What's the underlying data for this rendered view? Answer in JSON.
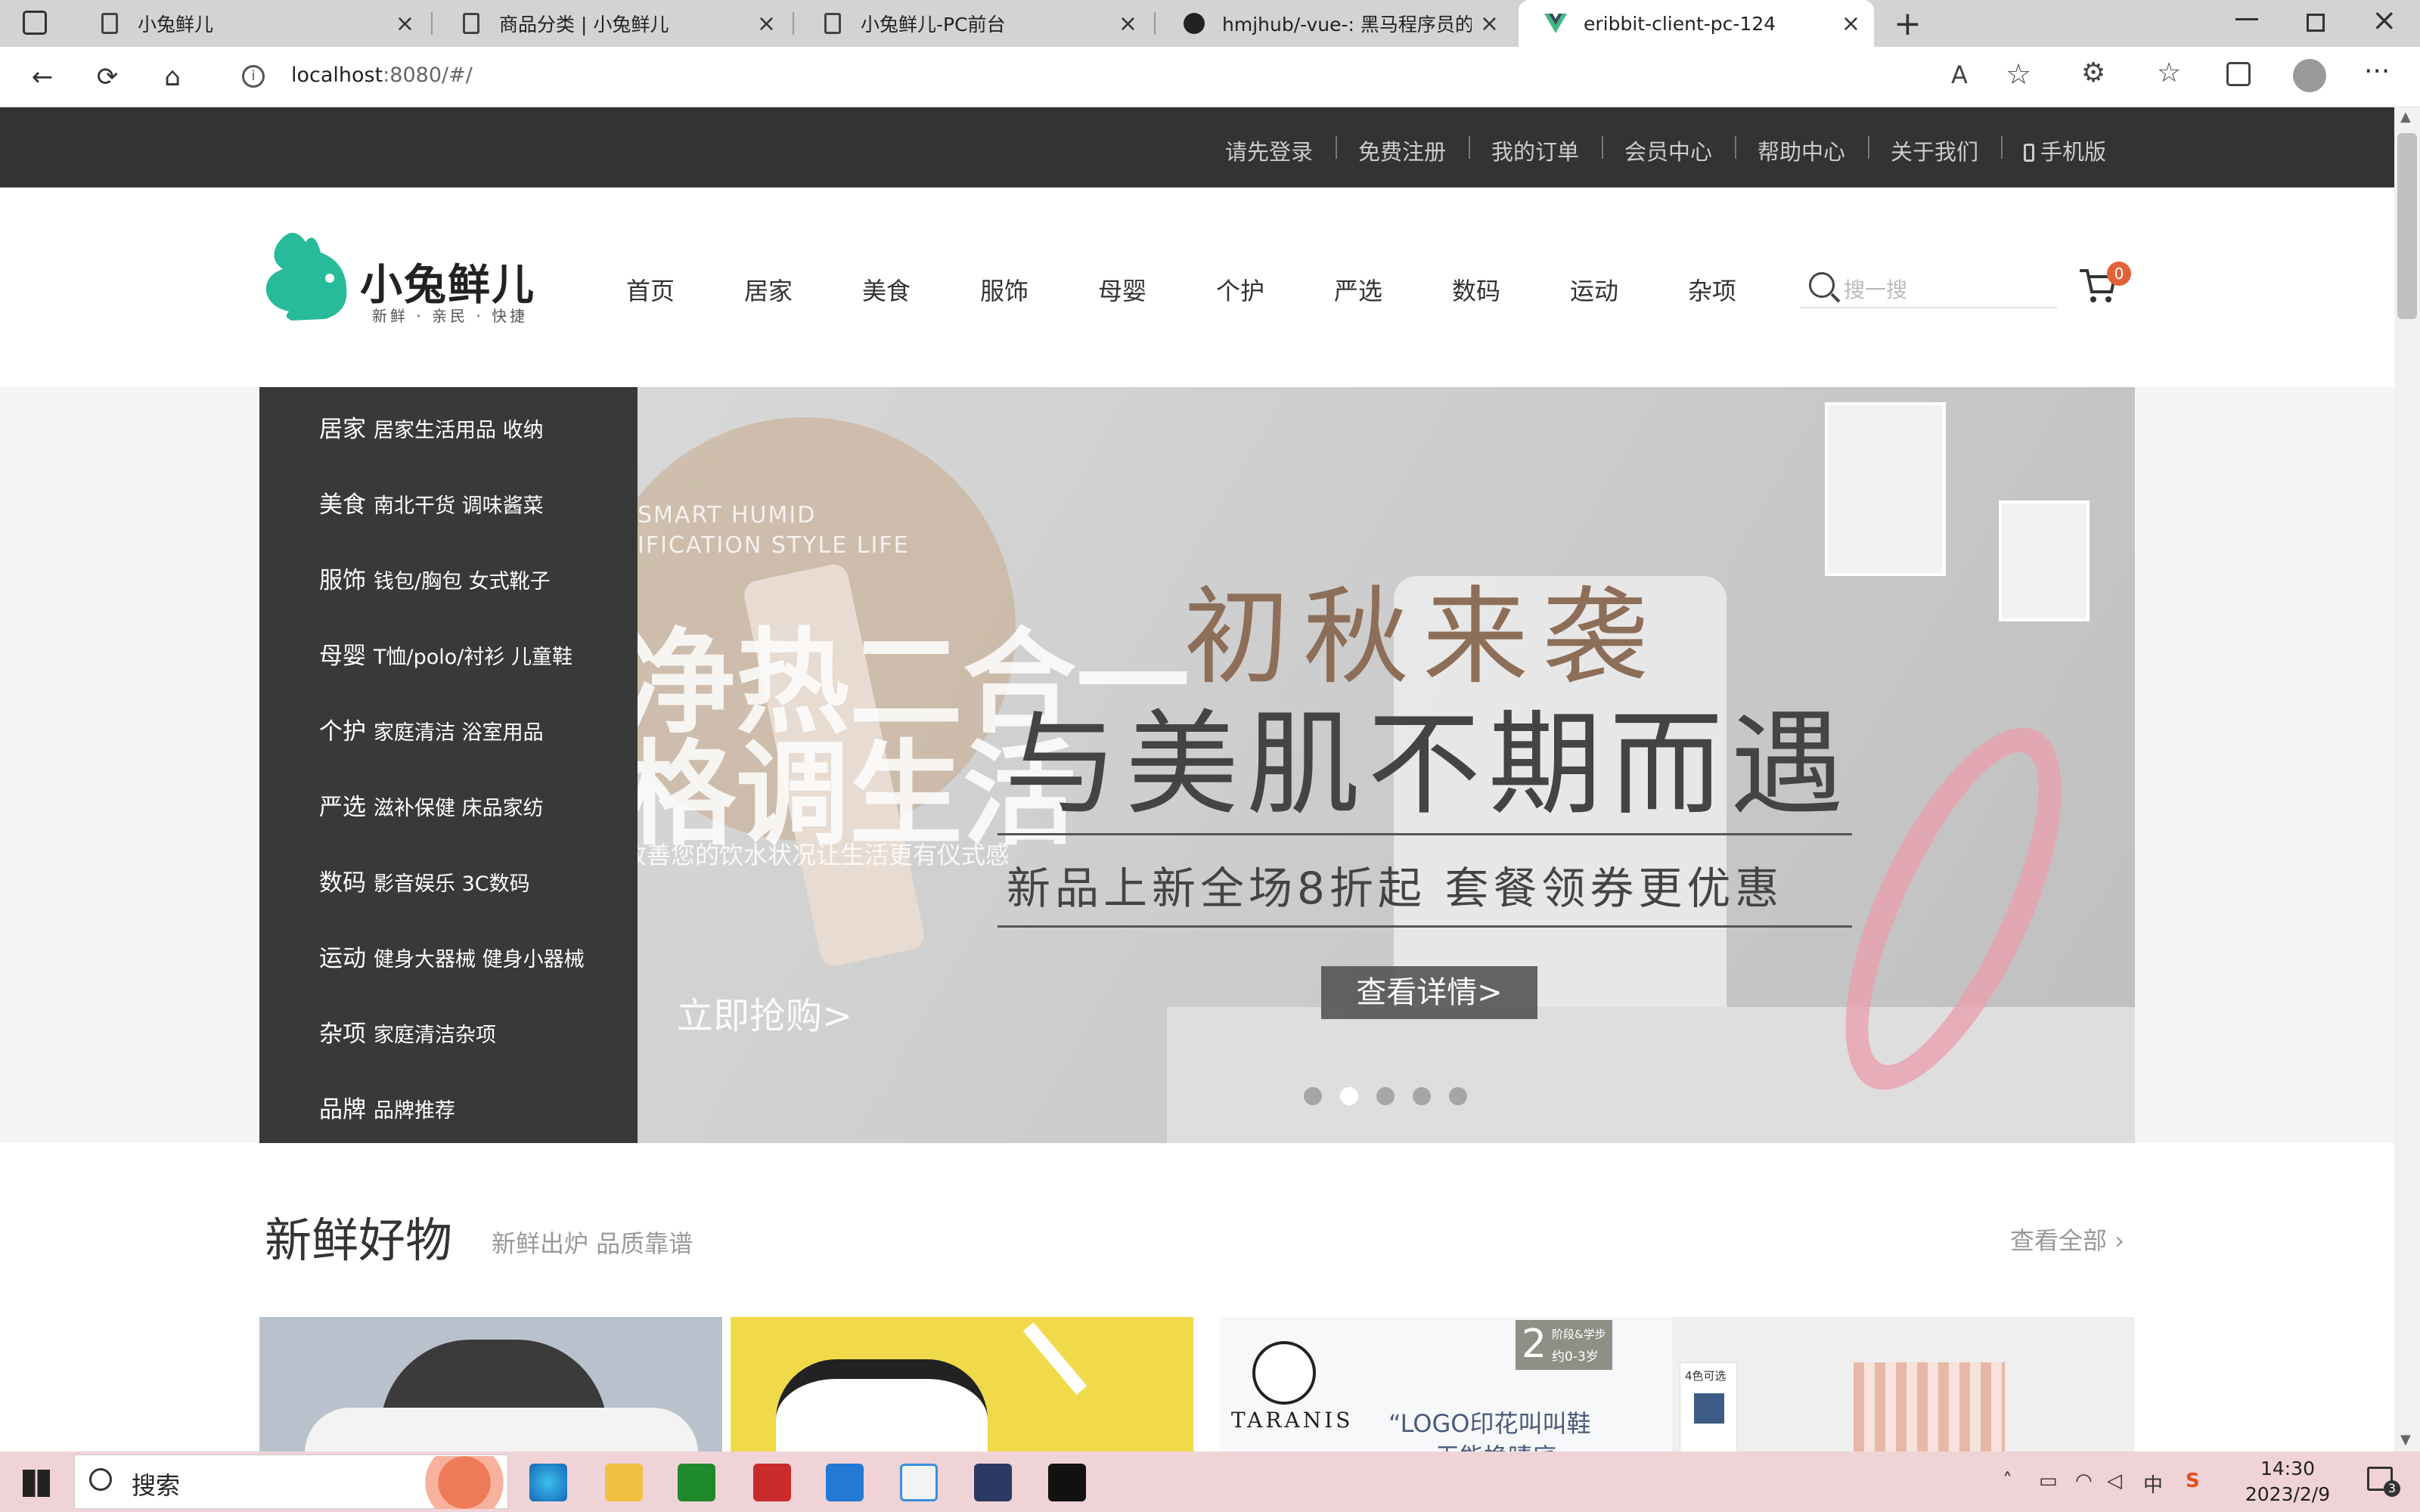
{
  "browser": {
    "tabs": [
      {
        "title": "小兔鲜儿",
        "icon": "page-icon",
        "active": false
      },
      {
        "title": "商品分类 | 小兔鲜儿",
        "icon": "page-icon",
        "active": false
      },
      {
        "title": "小兔鲜儿-PC前台",
        "icon": "page-icon",
        "active": false
      },
      {
        "title": "hmjhub/-vue-: 黑马程序员的一个",
        "icon": "github-icon",
        "active": false
      },
      {
        "title": "eribbit-client-pc-124",
        "icon": "vue-icon",
        "active": true
      }
    ],
    "url_host": "localhost",
    "url_rest": ":8080/#/"
  },
  "site": {
    "topnav": [
      "请先登录",
      "免费注册",
      "我的订单",
      "会员中心",
      "帮助中心",
      "关于我们",
      "手机版"
    ],
    "logo": {
      "name": "小兔鲜儿",
      "tagline": "新鲜 · 亲民 · 快捷"
    },
    "nav": [
      "首页",
      "居家",
      "美食",
      "服饰",
      "母婴",
      "个护",
      "严选",
      "数码",
      "运动",
      "杂项"
    ],
    "search_placeholder": "搜一搜",
    "cart_count": "0",
    "categories": [
      {
        "name": "居家",
        "subs": "居家生活用品 收纳"
      },
      {
        "name": "美食",
        "subs": "南北干货 调味酱菜"
      },
      {
        "name": "服饰",
        "subs": "钱包/胸包 女式靴子"
      },
      {
        "name": "母婴",
        "subs": "T恤/polo/衬衫 儿童鞋"
      },
      {
        "name": "个护",
        "subs": "家庭清洁 浴室用品"
      },
      {
        "name": "严选",
        "subs": "滋补保健 床品家纺"
      },
      {
        "name": "数码",
        "subs": "影音娱乐 3C数码"
      },
      {
        "name": "运动",
        "subs": "健身大器械 健身小器械"
      },
      {
        "name": "杂项",
        "subs": "家庭清洁杂项"
      },
      {
        "name": "品牌",
        "subs": "品牌推荐"
      }
    ],
    "banner": {
      "en_text": "SMART HUMID",
      "en_text2": "IFICATION STYLE LIFE",
      "left_line1": "净热二合一",
      "left_line2": "格调生活",
      "left_small": "改善您的饮水状况让生活更有仪式感",
      "left_cta": "立即抢购>",
      "right_line1": "初秋来袭",
      "right_line2": "与美肌不期而遇",
      "right_promo": "新品上新全场8折起 套餐领券更优惠",
      "right_cta": "查看详情>",
      "dots": 5,
      "active_dot": 1
    },
    "fresh": {
      "title": "新鲜好物",
      "subtitle": "新鲜出炉 品质靠谱",
      "view_all": "查看全部",
      "cards": [
        {
          "img": "man-portrait"
        },
        {
          "img": "sneaker-yellow"
        },
        {
          "badge_num": "2",
          "badge_txt1": "阶段&学步",
          "badge_txt2": "约0-3岁",
          "brand": "TARANIS",
          "slogan": "“LOGO印花叫叫鞋",
          "slogan2": "无能换晴底"
        },
        {
          "label": "4色可选"
        }
      ]
    }
  },
  "taskbar": {
    "search": "搜索",
    "time": "14:30",
    "date": "2023/2/9",
    "ime": "中",
    "notif": "3"
  },
  "colors": {
    "brand": "#27ba9b",
    "topbar": "#333333",
    "badge": "#e26237",
    "taskbar": "#f0d3d7"
  }
}
